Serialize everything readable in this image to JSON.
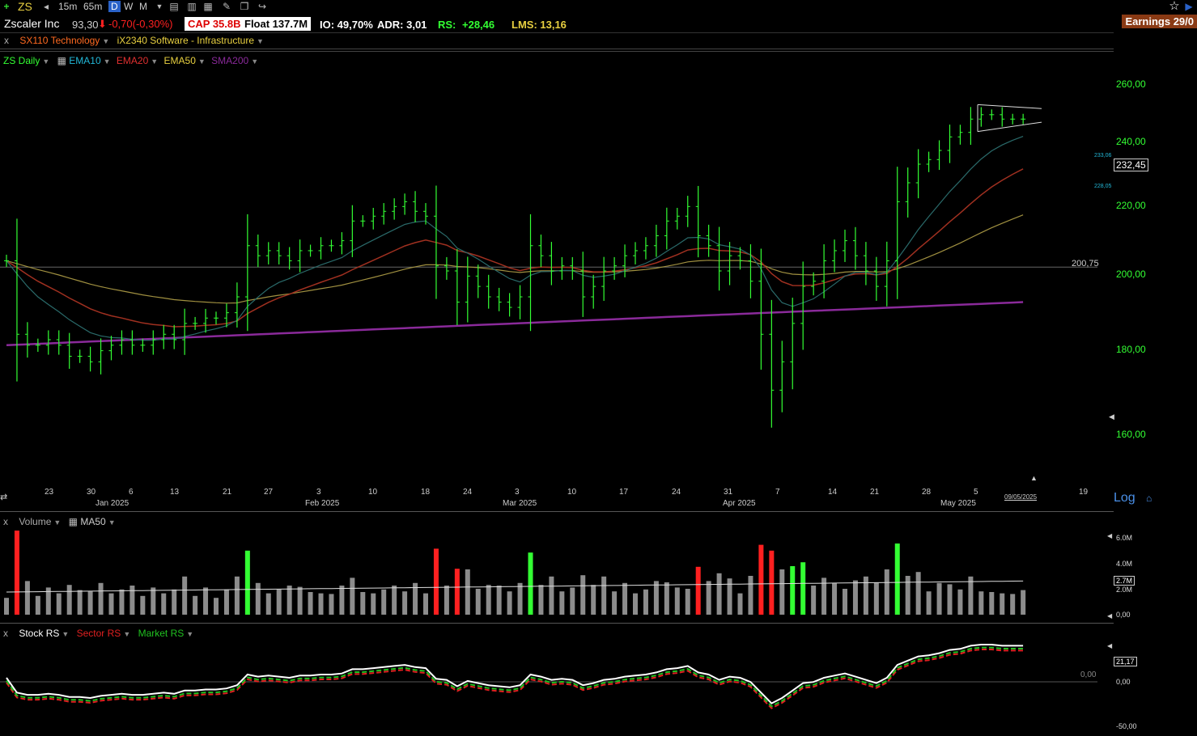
{
  "toolbar": {
    "symbol": "ZS",
    "timeframes": [
      "15m",
      "65m",
      "D",
      "W",
      "M"
    ],
    "active_timeframe": "D"
  },
  "info": {
    "name": "Zscaler Inc",
    "price": "93,30",
    "change": "-0,70(-0,30%)",
    "cap": "CAP 35.8B",
    "float": "Float 137.7M",
    "io": "IO: 49,70%",
    "adr": "ADR: 3,01",
    "rs_label": "RS:",
    "rs_value": "+28,46",
    "lms": "LMS: 13,16",
    "earnings": "Earnings 29/0"
  },
  "groups": {
    "sector": "SX110 Technology",
    "industry": "iX2340 Software - Infrastructure"
  },
  "price_panel": {
    "label": "ZS Daily",
    "indicators": [
      {
        "name": "EMA10",
        "color": "#22b8d8"
      },
      {
        "name": "EMA20",
        "color": "#e03030"
      },
      {
        "name": "EMA50",
        "color": "#e8d040"
      },
      {
        "name": "SMA200",
        "color": "#8a2a9a"
      }
    ],
    "y_ticks": [
      "260,00",
      "240,00",
      "220,00",
      "200,00",
      "180,00",
      "160,00"
    ],
    "hline_label": "200,75",
    "last_price": "232,45",
    "upper_mark": "233,06",
    "lower_mark": "228,05",
    "scale": "Log",
    "date_label": "09/05/2025"
  },
  "x_axis": {
    "days": [
      "23",
      "30",
      "6",
      "13",
      "21",
      "27",
      "3",
      "10",
      "18",
      "24",
      "3",
      "10",
      "17",
      "24",
      "31",
      "7",
      "14",
      "21",
      "28",
      "5",
      "19"
    ],
    "months": [
      "Jan 2025",
      "Feb 2025",
      "Mar 2025",
      "Apr 2025",
      "May 2025"
    ]
  },
  "volume_panel": {
    "label": "Volume",
    "ma_label": "MA50",
    "y_ticks": [
      "6.0M",
      "4.0M",
      "2.0M",
      "0,00"
    ],
    "current": "2.7M"
  },
  "rs_panel": {
    "series": [
      {
        "name": "Stock RS",
        "color": "#ffffff"
      },
      {
        "name": "Sector RS",
        "color": "#e02020"
      },
      {
        "name": "Market RS",
        "color": "#20c020"
      }
    ],
    "y_ticks": [
      "0,00",
      "-50,00"
    ],
    "zero_label": "0,00",
    "current": "21,17"
  },
  "colors": {
    "up": "#33ff33",
    "down": "#ff2020",
    "neutral_volume": "#8c8c8c",
    "price_axis": "#33ff33"
  },
  "chart_data": {
    "type": "ohlc",
    "ylim": [
      155,
      270
    ],
    "closes": [
      202,
      188,
      186,
      186,
      187,
      186,
      184,
      184,
      183,
      185,
      186,
      187,
      186,
      186,
      187,
      188,
      187,
      190,
      190,
      191,
      191,
      192,
      195,
      205,
      203,
      204,
      203,
      202,
      204,
      204,
      205,
      205,
      206,
      210,
      210,
      211,
      212,
      213,
      214,
      212,
      211,
      201,
      200,
      194,
      199,
      197,
      195,
      194,
      193,
      195,
      205,
      203,
      200,
      201,
      200,
      195,
      197,
      200,
      201,
      203,
      204,
      205,
      207,
      210,
      211,
      213,
      207,
      205,
      200,
      203,
      202,
      198,
      188,
      178,
      183,
      190,
      197,
      198,
      202,
      204,
      206,
      203,
      200,
      197,
      202,
      214,
      218,
      222,
      223,
      225,
      228,
      229,
      232,
      233,
      233,
      232,
      232,
      232
    ]
  }
}
